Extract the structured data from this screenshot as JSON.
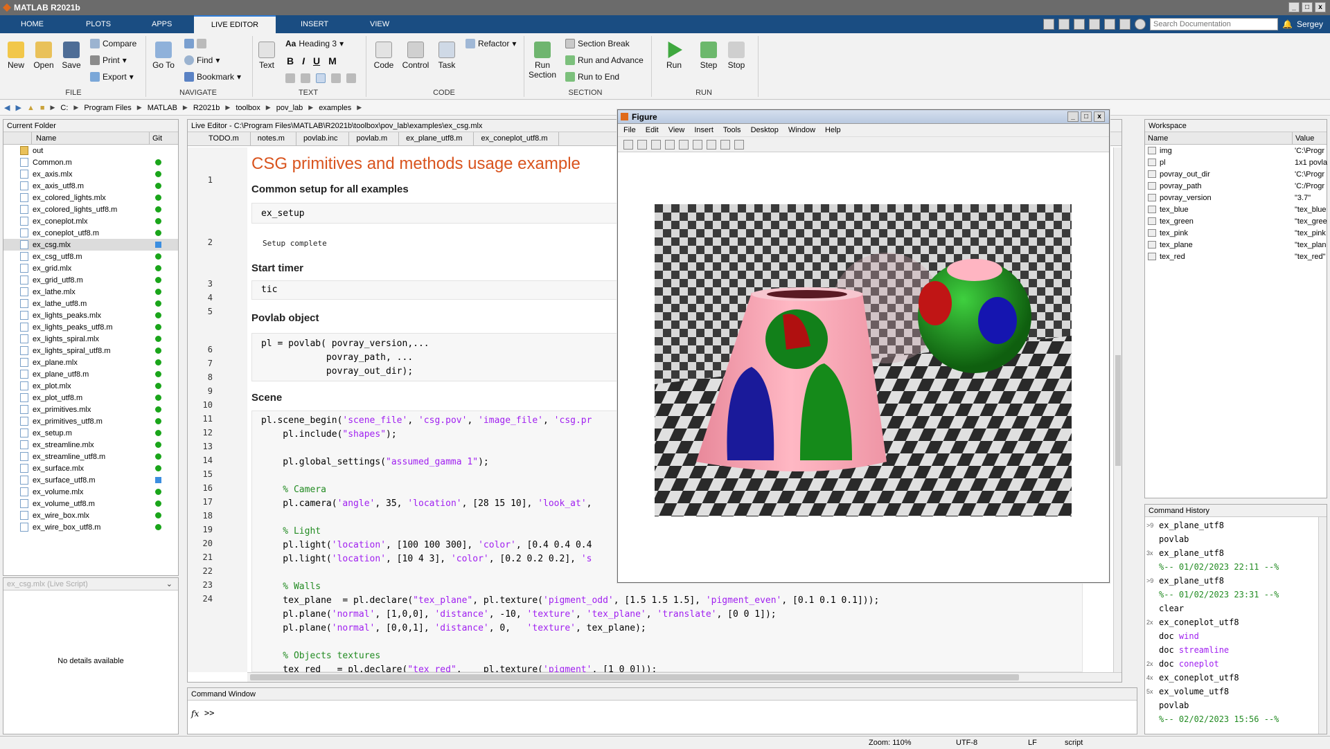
{
  "app": {
    "title": "MATLAB R2021b",
    "user": "Sergey"
  },
  "tabs": [
    {
      "label": "HOME"
    },
    {
      "label": "PLOTS"
    },
    {
      "label": "APPS"
    },
    {
      "label": "LIVE EDITOR"
    },
    {
      "label": "INSERT"
    },
    {
      "label": "VIEW"
    }
  ],
  "search": {
    "placeholder": "Search Documentation"
  },
  "ribbon": {
    "file": {
      "label": "FILE",
      "new": "New",
      "open": "Open",
      "save": "Save",
      "compare": "Compare",
      "print": "Print",
      "export": "Export"
    },
    "navigate": {
      "label": "NAVIGATE",
      "goto": "Go To",
      "find": "Find",
      "bookmark": "Bookmark"
    },
    "text": {
      "label": "TEXT",
      "text": "Text",
      "heading": "Heading 3",
      "bold": "B",
      "italic": "I",
      "underline": "U",
      "mono": "M"
    },
    "code": {
      "label": "CODE",
      "code": "Code",
      "control": "Control",
      "task": "Task",
      "refactor": "Refactor"
    },
    "section": {
      "label": "SECTION",
      "run_section": "Run Section",
      "section_break": "Section Break",
      "run_advance": "Run and Advance",
      "run_end": "Run to End"
    },
    "run": {
      "label": "RUN",
      "run": "Run",
      "step": "Step",
      "stop": "Stop"
    }
  },
  "address": [
    "C:",
    "Program Files",
    "MATLAB",
    "R2021b",
    "toolbox",
    "pov_lab",
    "examples"
  ],
  "current_folder": {
    "title": "Current Folder",
    "col_name": "Name",
    "col_git": "Git",
    "files": [
      {
        "name": "out",
        "status": "",
        "type": "folder"
      },
      {
        "name": "Common.m",
        "status": "ok"
      },
      {
        "name": "ex_axis.mlx",
        "status": "ok"
      },
      {
        "name": "ex_axis_utf8.m",
        "status": "ok"
      },
      {
        "name": "ex_colored_lights.mlx",
        "status": "ok"
      },
      {
        "name": "ex_colored_lights_utf8.m",
        "status": "ok"
      },
      {
        "name": "ex_coneplot.mlx",
        "status": "ok"
      },
      {
        "name": "ex_coneplot_utf8.m",
        "status": "ok"
      },
      {
        "name": "ex_csg.mlx",
        "status": "mod",
        "selected": true
      },
      {
        "name": "ex_csg_utf8.m",
        "status": "ok"
      },
      {
        "name": "ex_grid.mlx",
        "status": "ok"
      },
      {
        "name": "ex_grid_utf8.m",
        "status": "ok"
      },
      {
        "name": "ex_lathe.mlx",
        "status": "ok"
      },
      {
        "name": "ex_lathe_utf8.m",
        "status": "ok"
      },
      {
        "name": "ex_lights_peaks.mlx",
        "status": "ok"
      },
      {
        "name": "ex_lights_peaks_utf8.m",
        "status": "ok"
      },
      {
        "name": "ex_lights_spiral.mlx",
        "status": "ok"
      },
      {
        "name": "ex_lights_spiral_utf8.m",
        "status": "ok"
      },
      {
        "name": "ex_plane.mlx",
        "status": "ok"
      },
      {
        "name": "ex_plane_utf8.m",
        "status": "ok"
      },
      {
        "name": "ex_plot.mlx",
        "status": "ok"
      },
      {
        "name": "ex_plot_utf8.m",
        "status": "ok"
      },
      {
        "name": "ex_primitives.mlx",
        "status": "ok"
      },
      {
        "name": "ex_primitives_utf8.m",
        "status": "ok"
      },
      {
        "name": "ex_setup.m",
        "status": "ok"
      },
      {
        "name": "ex_streamline.mlx",
        "status": "ok"
      },
      {
        "name": "ex_streamline_utf8.m",
        "status": "ok"
      },
      {
        "name": "ex_surface.mlx",
        "status": "ok"
      },
      {
        "name": "ex_surface_utf8.m",
        "status": "mod"
      },
      {
        "name": "ex_volume.mlx",
        "status": "ok"
      },
      {
        "name": "ex_volume_utf8.m",
        "status": "ok"
      },
      {
        "name": "ex_wire_box.mlx",
        "status": "ok"
      },
      {
        "name": "ex_wire_box_utf8.m",
        "status": "ok"
      }
    ],
    "details_file": "ex_csg.mlx",
    "details_type": "(Live Script)",
    "no_details": "No details available"
  },
  "editor": {
    "title": "Live Editor - C:\\Program Files\\MATLAB\\R2021b\\toolbox\\pov_lab\\examples\\ex_csg.mlx",
    "tabs": [
      "TODO.m",
      "notes.m",
      "povlab.inc",
      "povlab.m",
      "ex_plane_utf8.m",
      "ex_coneplot_utf8.m"
    ],
    "doc_title": "CSG primitives and methods usage example",
    "h_setup": "Common setup for all examples",
    "setup_code": "ex_setup",
    "setup_out": "Setup complete",
    "h_timer": "Start timer",
    "timer_code": "tic",
    "h_obj": "Povlab object",
    "obj_l1": "pl = povlab( povray_version,...",
    "obj_l2": "            povray_path, ...",
    "obj_l3": "            povray_out_dir);",
    "h_scene": "Scene",
    "lines": [
      "1",
      "2",
      "3",
      "4",
      "5",
      "6",
      "7",
      "8",
      "9",
      "10",
      "11",
      "12",
      "13",
      "14",
      "15",
      "16",
      "17",
      "18",
      "19",
      "20",
      "21",
      "22",
      "23",
      "24"
    ]
  },
  "command_window": {
    "title": "Command Window",
    "prompt": ">>",
    "fx": "fx"
  },
  "workspace": {
    "title": "Workspace",
    "col_name": "Name",
    "col_value": "Value",
    "vars": [
      {
        "name": "img",
        "value": "'C:\\Progr"
      },
      {
        "name": "pl",
        "value": "1x1 povla"
      },
      {
        "name": "povray_out_dir",
        "value": "'C:\\Progr"
      },
      {
        "name": "povray_path",
        "value": "'C:/Progr"
      },
      {
        "name": "povray_version",
        "value": "\"3.7\""
      },
      {
        "name": "tex_blue",
        "value": "\"tex_blue"
      },
      {
        "name": "tex_green",
        "value": "\"tex_gree"
      },
      {
        "name": "tex_pink",
        "value": "\"tex_pink"
      },
      {
        "name": "tex_plane",
        "value": "\"tex_plan"
      },
      {
        "name": "tex_red",
        "value": "\"tex_red\""
      }
    ]
  },
  "history": {
    "title": "Command History",
    "items": [
      {
        "count": ">9",
        "text": "ex_plane_utf8"
      },
      {
        "count": "",
        "text": "povlab"
      },
      {
        "count": "3x",
        "text": "ex_plane_utf8"
      },
      {
        "count": "",
        "text": "%-- 01/02/2023 22:11 --%",
        "sep": true
      },
      {
        "count": ">9",
        "text": "ex_plane_utf8"
      },
      {
        "count": "",
        "text": "%-- 01/02/2023 23:31 --%",
        "sep": true
      },
      {
        "count": "",
        "text": "clear"
      },
      {
        "count": "2x",
        "text": "ex_coneplot_utf8"
      },
      {
        "count": "",
        "text": "doc ",
        "kw": "wind"
      },
      {
        "count": "",
        "text": "doc ",
        "kw": "streamline"
      },
      {
        "count": "2x",
        "text": "doc ",
        "kw": "coneplot"
      },
      {
        "count": "4x",
        "text": "ex_coneplot_utf8"
      },
      {
        "count": "5x",
        "text": "ex_volume_utf8"
      },
      {
        "count": "",
        "text": "povlab"
      },
      {
        "count": "",
        "text": "%-- 02/02/2023 15:56 --%",
        "sep": true
      }
    ]
  },
  "figure": {
    "title": "Figure",
    "menu": [
      "File",
      "Edit",
      "View",
      "Insert",
      "Tools",
      "Desktop",
      "Window",
      "Help"
    ]
  },
  "status": {
    "zoom": "Zoom: 110%",
    "encoding": "UTF-8",
    "eol": "LF",
    "type": "script"
  },
  "colors": {
    "tabbar": "#1a4d82",
    "heading": "#d9541e",
    "string": "#a020f0",
    "comment": "#228b22"
  }
}
